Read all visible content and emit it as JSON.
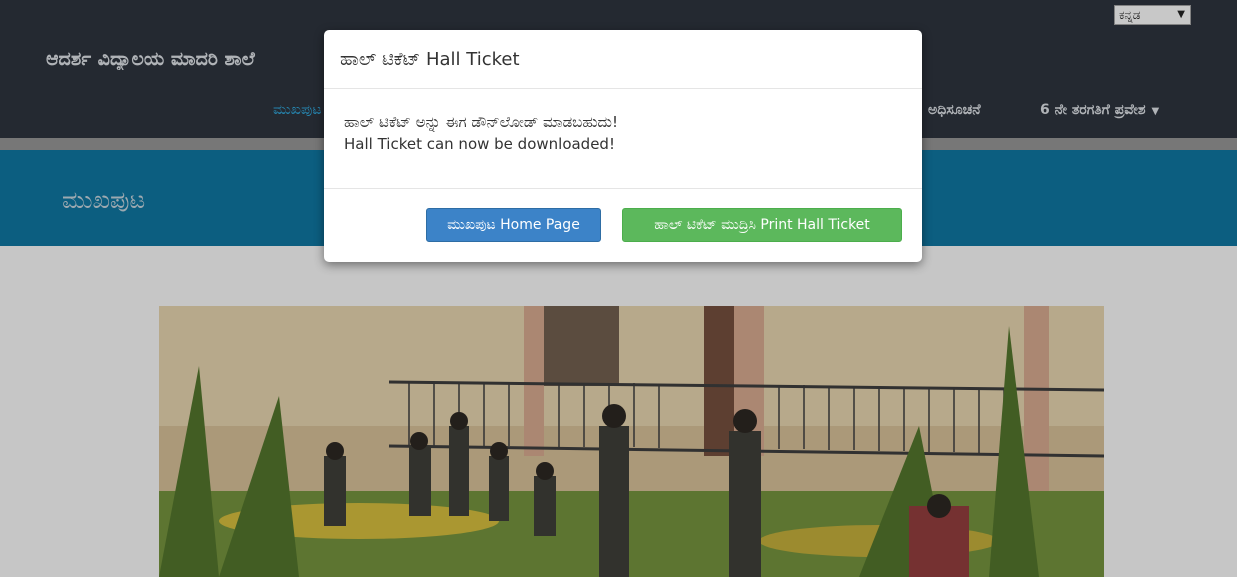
{
  "header": {
    "language_select": "ಕನ್ನಡ",
    "brand": "ಆದರ್ಶ ವಿದ್ಯಾಲಯ ಮಾದರಿ ಶಾಲೆ",
    "nav": {
      "home": "ಮುಖಪುಟ",
      "notice": "ಅಧಿಸೂಚನೆ",
      "admission": "6 ನೇ ತರಗತಿಗೆ ಪ್ರವೇಶ"
    }
  },
  "banner": {
    "title": "ಮುಖಪುಟ"
  },
  "modal": {
    "title": "ಹಾಲ್ ಟಿಕೆಟ್ Hall Ticket",
    "message_kn": "ಹಾಲ್ ಟಿಕೆಟ್ ಅನ್ನು ಈಗ ಡೌನ್‌ಲೋಡ್ ಮಾಡಬಹುದು!",
    "message_en": "Hall Ticket can now be downloaded!",
    "home_button": "ಮುಖಪುಟ Home Page",
    "print_button": "ಹಾಲ್ ಟಿಕೆಟ್ ಮುದ್ರಿಸಿ Print Hall Ticket"
  },
  "colors": {
    "topbar": "#2b313a",
    "banner": "#0f6f97",
    "primary_button": "#3c83c8",
    "success_button": "#5cb85c"
  }
}
